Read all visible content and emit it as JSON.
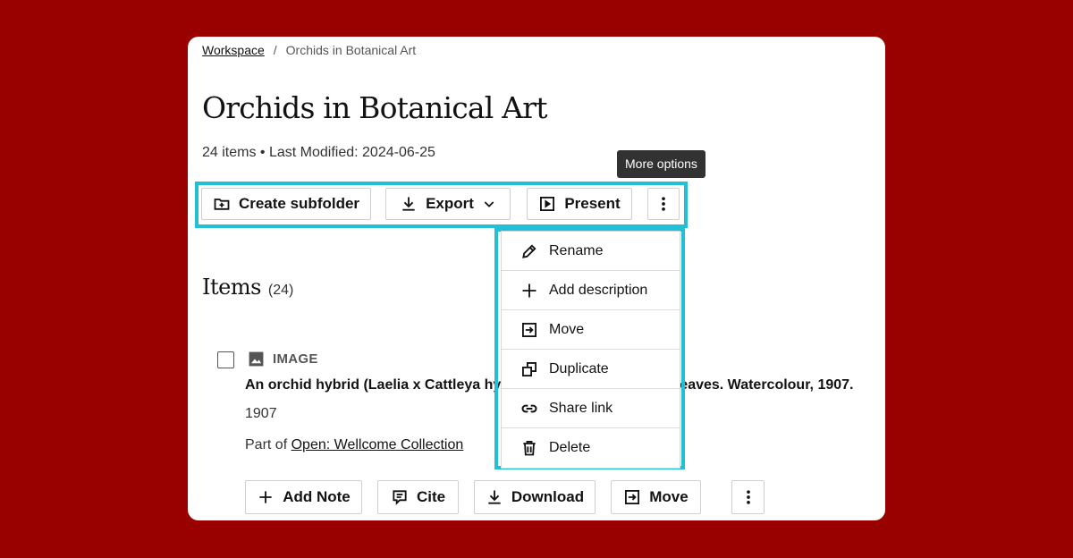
{
  "breadcrumb": {
    "root": "Workspace",
    "separator": "/",
    "current": "Orchids in Botanical Art"
  },
  "page": {
    "title": "Orchids in Botanical Art",
    "meta": "24 items • Last Modified: 2024-06-25"
  },
  "tooltip": {
    "text": "More options"
  },
  "toolbar": {
    "create_subfolder": "Create subfolder",
    "export": "Export",
    "present": "Present"
  },
  "menu": {
    "items": [
      {
        "label": "Rename",
        "icon": "pencil-icon"
      },
      {
        "label": "Add description",
        "icon": "plus-icon"
      },
      {
        "label": "Move",
        "icon": "move-icon"
      },
      {
        "label": "Duplicate",
        "icon": "duplicate-icon"
      },
      {
        "label": "Share link",
        "icon": "link-icon"
      },
      {
        "label": "Delete",
        "icon": "trash-icon"
      }
    ]
  },
  "items": {
    "heading": "Items",
    "count": "(24)",
    "list": [
      {
        "type": "IMAGE",
        "title": "An orchid hybrid (Laelia x Cattleya hybrid): flowering stem and leaves. Watercolour, 1907.",
        "date": "1907",
        "source_prefix": "Part of",
        "source_link": "Open: Wellcome Collection",
        "actions": {
          "add_note": "Add Note",
          "cite": "Cite",
          "download": "Download",
          "move": "Move"
        }
      }
    ]
  },
  "colors": {
    "background": "#990000",
    "highlight": "#21c0d6",
    "tooltip": "#323232"
  }
}
